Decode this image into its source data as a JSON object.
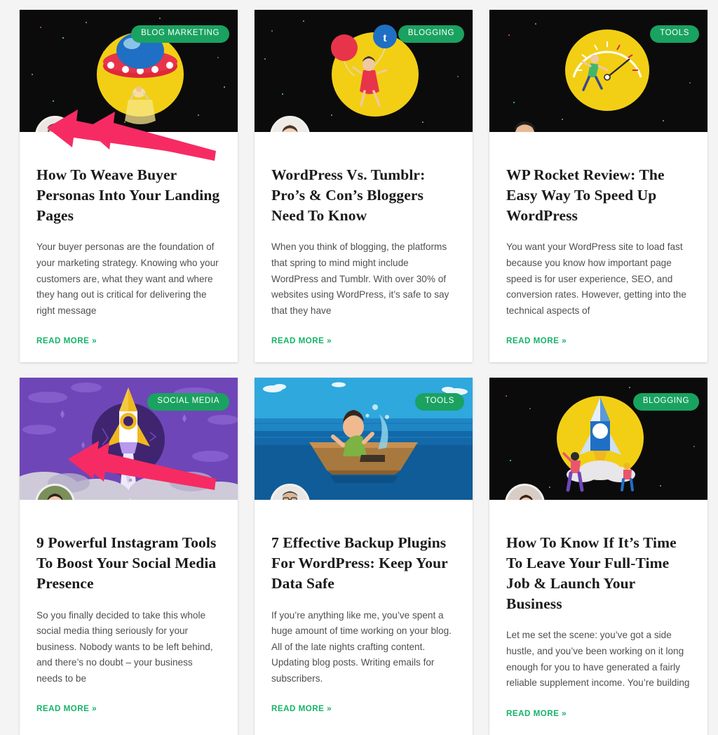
{
  "page": {
    "background_color": "#f4f4f4",
    "badge_color": "#1aa260",
    "link_color": "#14b368",
    "arrow_color": "#F72B63",
    "read_more_label": "READ MORE »"
  },
  "cards": [
    {
      "category": "BLOG MARKETING",
      "title": "How To Weave Buyer Personas Into Your Landing Pages",
      "excerpt": "Your buyer personas are the foundation of your marketing strategy. Knowing who your customers are, what they want and where they hang out is critical for delivering the right message",
      "read_more": "READ MORE »",
      "hero": "ufo-abducting-person-on-black-starfield",
      "avatar": "man-with-glasses-headshot",
      "has_arrow": false
    },
    {
      "category": "BLOGGING",
      "title": "WordPress Vs. Tumblr: Pro’s & Con’s Bloggers Need To Know",
      "excerpt": "When you think of blogging, the platforms that spring to mind might include WordPress and Tumblr. With over 30% of websites using WordPress, it’s safe to say that they have",
      "read_more": "READ MORE »",
      "hero": "girl-with-balloons-tumblr-logo-on-black-starfield",
      "avatar": "woman-with-long-hair-headshot",
      "has_arrow": true
    },
    {
      "category": "TOOLS",
      "title": "WP Rocket Review: The Easy Way To Speed Up WordPress",
      "excerpt": "You want your WordPress site to load fast because you know how important page speed is for user experience, SEO, and conversion rates. However, getting into the technical aspects of",
      "read_more": "READ MORE »",
      "hero": "runner-with-speed-gauge-on-black-starfield",
      "avatar": "man-smiling-cutout-headshot",
      "has_arrow": true
    },
    {
      "category": "SOCIAL MEDIA",
      "title": "9 Powerful Instagram Tools To Boost Your Social Media Presence",
      "excerpt": "So you finally decided to take this whole social media thing seriously for your business. Nobody wants to be left behind, and there’s no doubt – your business needs to be",
      "read_more": "READ MORE »",
      "hero": "rocket-launching-through-purple-clouds",
      "avatar": "woman-with-glasses-and-scarf-headshot",
      "has_arrow": true
    },
    {
      "category": "TOOLS",
      "title": "7 Effective Backup Plugins For WordPress: Keep Your Data Safe",
      "excerpt": "If you’re anything like me, you’ve spent a huge amount of time working on your blog. All of the late nights crafting content. Updating blog posts. Writing emails for subscribers.",
      "read_more": "READ MORE »",
      "hero": "man-bailing-water-from-sinking-boat-at-sea",
      "avatar": "man-with-glasses-headshot",
      "has_arrow": false
    },
    {
      "category": "BLOGGING",
      "title": "How To Know If It’s Time To Leave Your Full-Time Job & Launch Your Business",
      "excerpt": "Let me set the scene: you’ve got a side hustle, and you’ve been working on it long enough for you to have generated a fairly reliable supplement income. You’re building",
      "read_more": "READ MORE »",
      "hero": "rocket-with-people-on-yellow-circle-black-starfield",
      "avatar": "woman-holding-mug-headshot",
      "has_arrow": true
    }
  ]
}
